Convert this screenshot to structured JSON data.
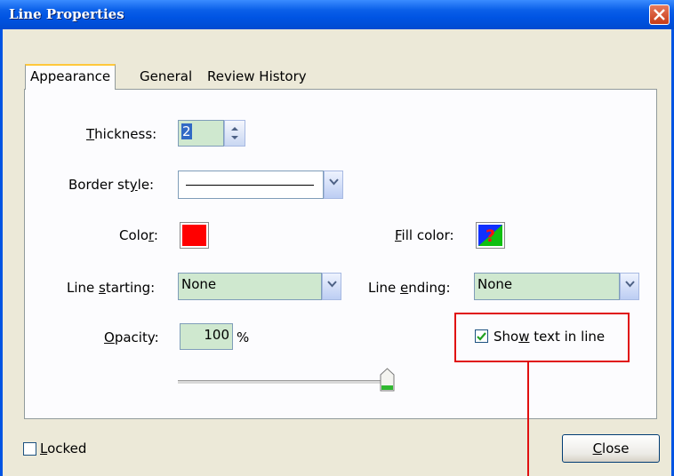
{
  "window": {
    "title": "Line Properties"
  },
  "tabs": [
    {
      "label": "Appearance",
      "active": true
    },
    {
      "label": "General",
      "active": false
    },
    {
      "label": "Review History",
      "active": false
    }
  ],
  "appearance": {
    "thickness": {
      "label_pre": "",
      "label_key": "T",
      "label_post": "hickness:",
      "value": "2"
    },
    "border_style": {
      "label_pre": "Border st",
      "label_key": "y",
      "label_post": "le:"
    },
    "color": {
      "label_pre": "Colo",
      "label_key": "r",
      "label_post": ":",
      "value": "#ff0000"
    },
    "fill_color": {
      "label_pre": "",
      "label_key": "F",
      "label_post": "ill color:"
    },
    "line_starting": {
      "label_pre": "Line ",
      "label_key": "s",
      "label_post": "tarting:",
      "value": "None"
    },
    "line_ending": {
      "label_pre": "Line ",
      "label_key": "e",
      "label_post": "nding:",
      "value": "None"
    },
    "opacity": {
      "label_pre": "",
      "label_key": "O",
      "label_post": "pacity:",
      "value": "100",
      "unit": "%",
      "slider_fraction": 1.0
    },
    "show_text": {
      "label_pre": "Sho",
      "label_key": "w",
      "label_post": " text in line",
      "checked": true
    }
  },
  "footer": {
    "locked": {
      "label_key": "L",
      "label_post": "ocked",
      "checked": false
    },
    "close": {
      "label_key": "C",
      "label_post": "lose"
    }
  },
  "colors": {
    "titlebar": "#0054e3",
    "highlight_box": "#e01010",
    "field_bg": "#cfe8cf"
  }
}
